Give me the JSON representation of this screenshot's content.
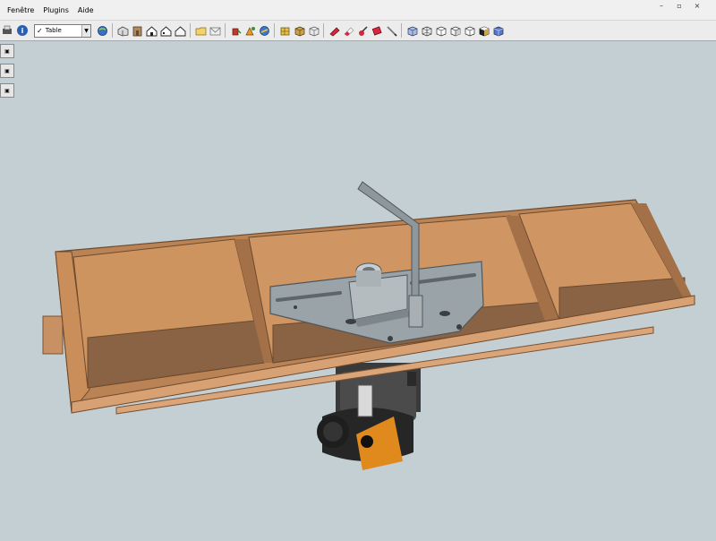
{
  "menu": {
    "items": [
      "Fenêtre",
      "Plugins",
      "Aide"
    ]
  },
  "layer_select": {
    "value": "Table",
    "check": "✓"
  },
  "toolbar": {
    "icons": [
      "print-icon",
      "model-info-icon",
      "iso-view-icon",
      "front-view-icon",
      "house-view-icon",
      "house-outline-icon",
      "house-side-icon",
      "folder-icon",
      "envelope-icon",
      "paint-bucket-icon",
      "follow-me-icon",
      "tape-measure-icon",
      "sandbox-icon",
      "box-plugin-icon",
      "cube-plugin-icon",
      "eraser-red-icon",
      "eraser-white-icon",
      "dropper-red-icon",
      "marker-red-icon",
      "pencil-icon",
      "style-xray-icon",
      "style-wireframe-icon",
      "style-hidden-line-icon",
      "style-shaded-icon",
      "style-textured-icon",
      "style-monochrome-icon",
      "style-back-edges-icon"
    ],
    "info_label": "i"
  },
  "colors": {
    "sky": "#c4cfd4",
    "wood": "#c98e5a",
    "wood_dark": "#8a6244",
    "wood_side": "#b07a4f",
    "metal": "#9aa3a8",
    "metal_dark": "#5f666b",
    "router_orange": "#e08a1e"
  }
}
